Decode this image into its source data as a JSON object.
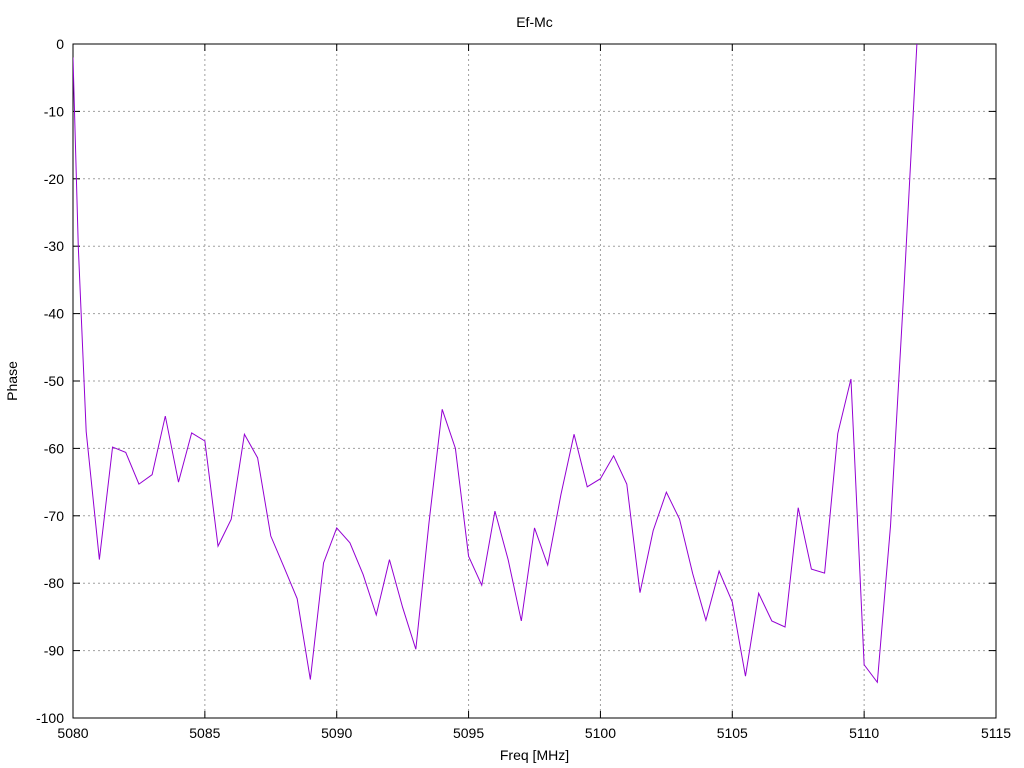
{
  "chart_data": {
    "type": "line",
    "title": "Ef-Mc",
    "xlabel": "Freq [MHz]",
    "ylabel": "Phase",
    "xlim": [
      5080,
      5115
    ],
    "ylim": [
      -100,
      0
    ],
    "xticks": [
      5080,
      5085,
      5090,
      5095,
      5100,
      5105,
      5110,
      5115
    ],
    "yticks": [
      0,
      -10,
      -20,
      -30,
      -40,
      -50,
      -60,
      -70,
      -80,
      -90,
      -100
    ],
    "grid": true,
    "legend": "none",
    "series": [
      {
        "color": "#9400d3",
        "x": [
          5080.0,
          5080.2,
          5080.5,
          5081.0,
          5081.5,
          5082.0,
          5082.5,
          5083.0,
          5083.5,
          5084.0,
          5084.5,
          5085.0,
          5085.5,
          5086.0,
          5086.5,
          5087.0,
          5087.5,
          5088.0,
          5088.5,
          5089.0,
          5089.5,
          5090.0,
          5090.5,
          5091.0,
          5091.5,
          5092.0,
          5092.5,
          5093.0,
          5093.5,
          5094.0,
          5094.5,
          5095.0,
          5095.5,
          5096.0,
          5096.5,
          5097.0,
          5097.5,
          5098.0,
          5098.5,
          5099.0,
          5099.5,
          5100.0,
          5100.5,
          5101.0,
          5101.5,
          5102.0,
          5102.5,
          5103.0,
          5103.5,
          5104.0,
          5104.5,
          5105.0,
          5105.5,
          5106.0,
          5106.5,
          5107.0,
          5107.5,
          5108.0,
          5108.5,
          5109.0,
          5109.5,
          5110.0,
          5110.5,
          5111.0,
          5111.5,
          5112.0
        ],
        "y": [
          -2.0,
          -30.0,
          -57.5,
          -76.5,
          -59.8,
          -60.6,
          -65.3,
          -63.9,
          -55.2,
          -65.0,
          -57.7,
          -58.9,
          -74.5,
          -70.5,
          -57.9,
          -61.4,
          -73.0,
          -77.6,
          -82.3,
          -94.3,
          -77.0,
          -71.8,
          -74.0,
          -78.7,
          -84.7,
          -76.5,
          -83.6,
          -89.8,
          -71.0,
          -54.2,
          -60.0,
          -76.0,
          -80.3,
          -69.3,
          -76.5,
          -85.6,
          -71.8,
          -77.3,
          -66.9,
          -57.9,
          -65.7,
          -64.5,
          -61.1,
          -65.3,
          -81.4,
          -72.2,
          -66.5,
          -70.5,
          -78.6,
          -85.5,
          -78.2,
          -82.8,
          -93.8,
          -81.5,
          -85.6,
          -86.5,
          -68.8,
          -77.9,
          -78.5,
          -57.8,
          -49.7,
          -92.1,
          -94.7,
          -71.5,
          -37.0,
          0.0
        ]
      }
    ]
  }
}
